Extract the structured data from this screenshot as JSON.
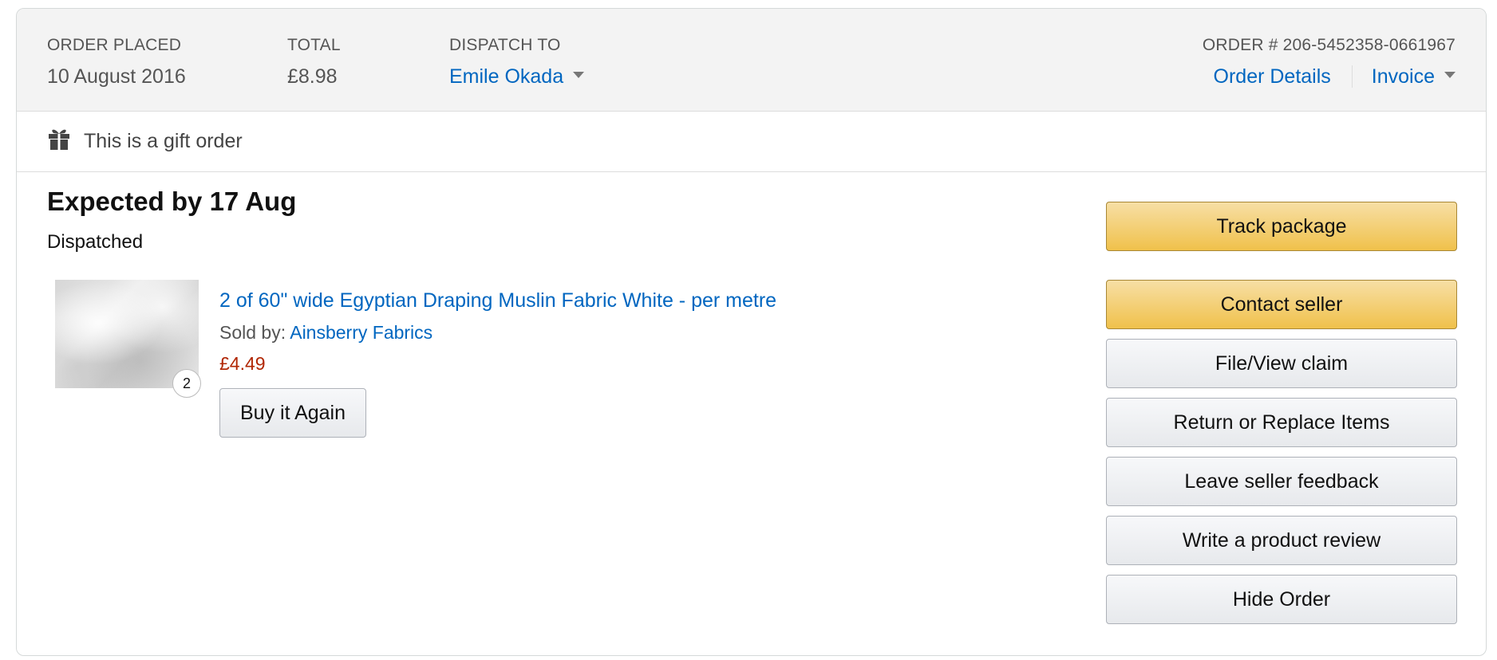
{
  "header": {
    "order_placed_label": "ORDER PLACED",
    "order_placed_value": "10 August 2016",
    "total_label": "TOTAL",
    "total_value": "£8.98",
    "dispatch_label": "DISPATCH TO",
    "dispatch_value": "Emile Okada",
    "order_number_label": "ORDER # 206-5452358-0661967",
    "order_details_link": "Order Details",
    "invoice_link": "Invoice"
  },
  "gift": {
    "icon": "gift-icon",
    "text": "This is a gift order"
  },
  "shipment": {
    "expected": "Expected by 17 Aug",
    "status": "Dispatched"
  },
  "item": {
    "title": "2 of 60\" wide Egyptian Draping Muslin Fabric White - per metre",
    "sold_by_label": "Sold by:",
    "seller": "Ainsberry Fabrics",
    "price": "£4.49",
    "quantity": "2",
    "buy_again_label": "Buy it Again"
  },
  "actions": {
    "track_package": "Track package",
    "contact_seller": "Contact seller",
    "file_claim": "File/View claim",
    "return_replace": "Return or Replace Items",
    "seller_feedback": "Leave seller feedback",
    "product_review": "Write a product review",
    "hide_order": "Hide Order"
  },
  "colors": {
    "link": "#0066c0",
    "price": "#b12704",
    "primary_button": "#f0c14b",
    "header_bg": "#f3f3f3"
  }
}
